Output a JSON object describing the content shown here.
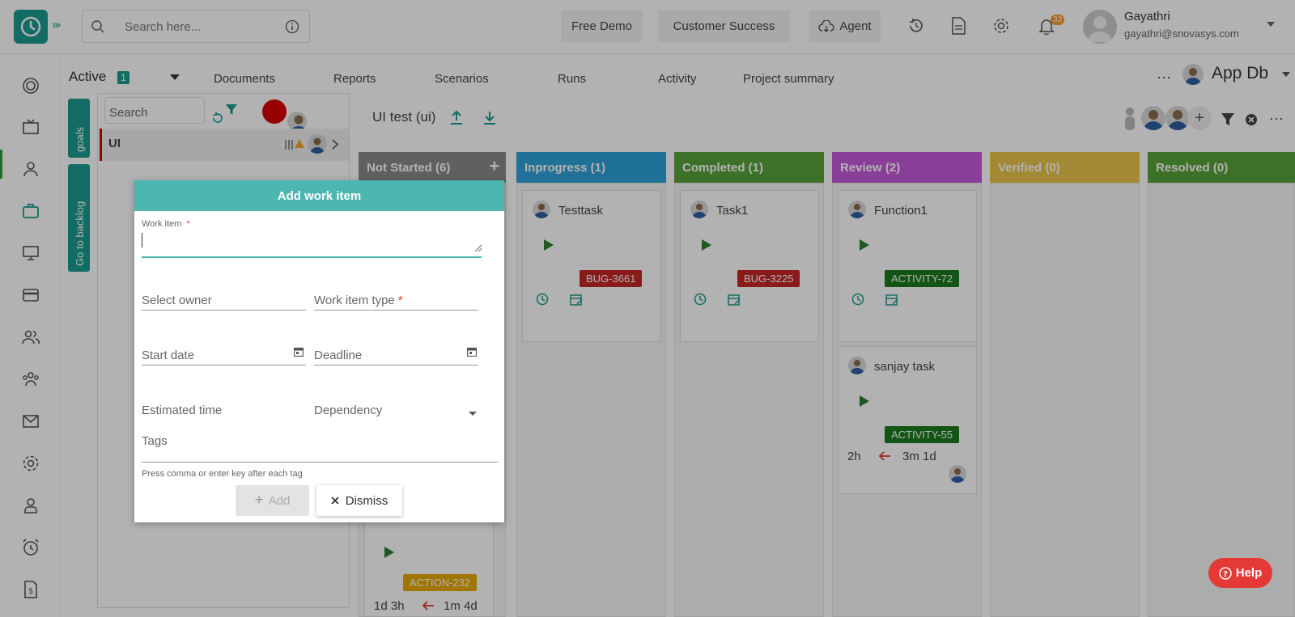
{
  "header": {
    "search_placeholder": "Search here...",
    "buttons": {
      "free_demo": "Free Demo",
      "customer_success": "Customer Success",
      "agent": "Agent"
    },
    "notification_count": "33",
    "user": {
      "name": "Gayathri",
      "email": "gayathri@snovasys.com"
    }
  },
  "subnav": {
    "status_label": "Active",
    "status_count": "1",
    "tabs": [
      "Documents",
      "Reports",
      "Scenarios",
      "Runs",
      "Activity",
      "Project summary"
    ],
    "project_name": "App Db"
  },
  "left_panel": {
    "goals_label": "goals",
    "backlog_label": "Go to backlog",
    "search_placeholder": "Search",
    "goal_item": "UI"
  },
  "board": {
    "title": "UI test (ui)",
    "columns": [
      {
        "label": "Not Started (6)",
        "color": "#8a8a8a"
      },
      {
        "label": "Inprogress (1)",
        "color": "#2fa3d8"
      },
      {
        "label": "Completed (1)",
        "color": "#5aa33a"
      },
      {
        "label": "Review (2)",
        "color": "#c45bd8"
      },
      {
        "label": "Verified (0)",
        "color": "#e9c44a"
      },
      {
        "label": "Resolved (0)",
        "color": "#5aa33a"
      }
    ],
    "cards": {
      "testtask": {
        "title": "Testtask",
        "tag": "BUG-3661"
      },
      "task1": {
        "title": "Task1",
        "tag": "BUG-3225"
      },
      "function1": {
        "title": "Function1",
        "tag": "ACTIVITY-72"
      },
      "sanjay": {
        "title": "sanjay task",
        "tag": "ACTIVITY-55",
        "estimate": "2h",
        "elapsed": "3m 1d"
      },
      "not_started_bottom": {
        "tag": "ACTION-232",
        "estimate": "1d 3h",
        "elapsed": "1m 4d"
      }
    }
  },
  "modal": {
    "title": "Add work item",
    "work_item_label": "Work item",
    "required_mark": "*",
    "select_owner": "Select owner",
    "work_item_type": "Work item type",
    "start_date": "Start date",
    "deadline": "Deadline",
    "estimated_time": "Estimated time",
    "dependency": "Dependency",
    "tags": "Tags",
    "tags_hint": "Press comma or enter key after each tag",
    "add_button": "Add",
    "dismiss_button": "Dismiss"
  },
  "help_label": "Help",
  "colors": {
    "brand": "#1a9b8e",
    "modal_header": "#4db6b1",
    "help": "#e53935"
  }
}
